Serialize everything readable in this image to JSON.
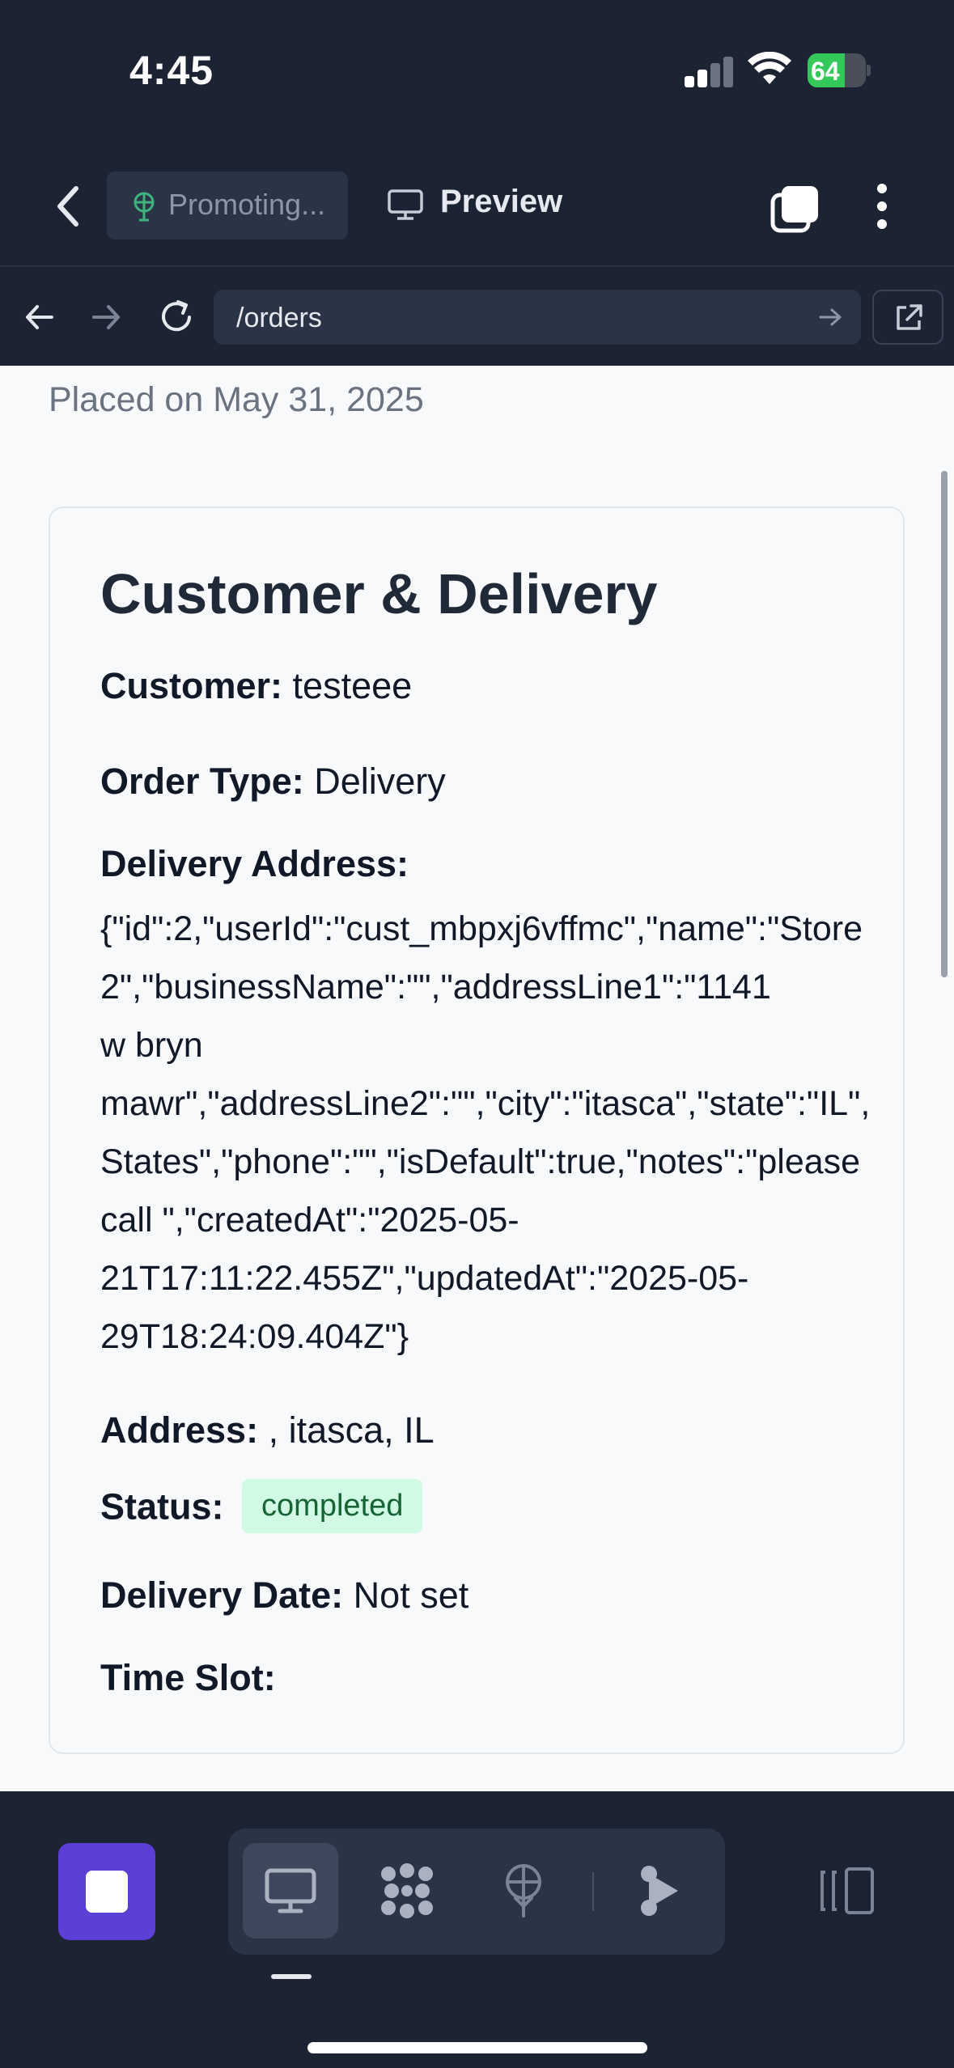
{
  "status_bar": {
    "time": "4:45",
    "battery_percent": "64",
    "battery_level": 0.64,
    "icons": [
      "cellular-signal-icon",
      "wifi-icon",
      "battery-charging-icon"
    ]
  },
  "app_bar": {
    "back_icon": "chevron-left-icon",
    "promoting_label": "Promoting...",
    "promoting_icon": "satellite-dish-icon",
    "preview_label": "Preview",
    "preview_icon": "monitor-icon",
    "tabs_icon": "tabs-icon",
    "more_icon": "more-vertical-icon"
  },
  "url_bar": {
    "url": "/orders",
    "back_icon": "arrow-left-icon",
    "forward_icon": "arrow-right-icon",
    "reload_icon": "reload-icon",
    "go_icon": "arrow-right-icon",
    "external_icon": "external-link-icon"
  },
  "order": {
    "placed_on": "Placed on May 31, 2025",
    "card_title": "Customer & Delivery",
    "customer_label": "Customer:",
    "customer_value": "testeee",
    "order_type_label": "Order Type:",
    "order_type_value": "Delivery",
    "delivery_address_label": "Delivery Address:",
    "delivery_address_lines": [
      "{\"id\":2,\"userId\":\"cust_mbpxj6vffmc\",\"name\":\"Store",
      "2\",\"businessName\":\"\",\"addressLine1\":\"1141",
      "w bryn",
      "mawr\",\"addressLine2\":\"\",\"city\":\"itasca\",\"state\":\"IL\",",
      "States\",\"phone\":\"\",\"isDefault\":true,\"notes\":\"please",
      "call \",\"createdAt\":\"2025-05-",
      "21T17:11:22.455Z\",\"updatedAt\":\"2025-05-",
      "29T18:24:09.404Z\"}"
    ],
    "address_label": "Address:",
    "address_value": ", itasca, IL",
    "status_label": "Status:",
    "status_value": "completed",
    "delivery_date_label": "Delivery Date:",
    "delivery_date_value": "Not set",
    "time_slot_label": "Time Slot:",
    "time_slot_value": ""
  },
  "bottom_bar": {
    "stop_icon": "stop-icon",
    "tools": [
      "monitor-icon",
      "apps-grid-icon",
      "satellite-dish-icon",
      "play-branch-icon"
    ],
    "active_tool": "monitor-icon",
    "layout_icon": "split-view-icon"
  },
  "colors": {
    "dark_bg": "#1c2333",
    "pill_bg": "#2b3446",
    "accent_purple": "#5b3fd6",
    "status_completed_bg": "#d1fae5",
    "status_completed_text": "#166534",
    "battery_green": "#34c759"
  }
}
